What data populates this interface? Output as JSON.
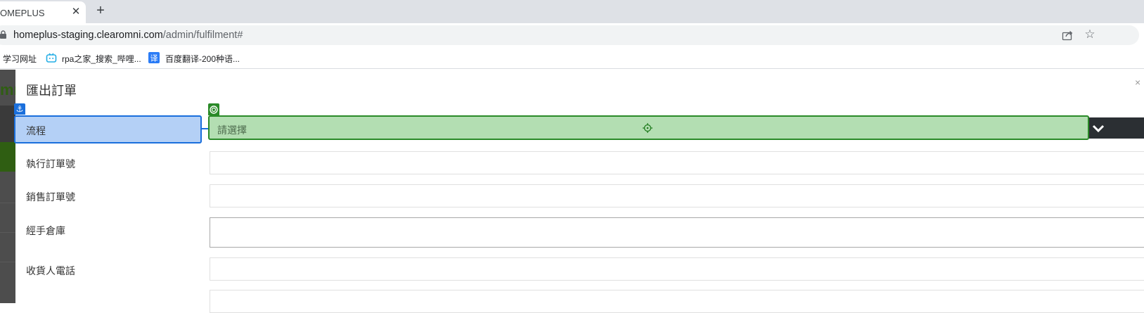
{
  "browser": {
    "tab_title": "OMEPLUS",
    "tab_close": "✕",
    "new_tab": "+",
    "url_host": "homeplus-staging.clearomni.com",
    "url_path": "/admin/fulfilment#",
    "bookmarks": [
      {
        "label": "学习网址",
        "icon": "none"
      },
      {
        "label": "rpa之家_搜索_哔哩...",
        "icon": "bilibili-icon"
      },
      {
        "label": "百度翻译-200种语...",
        "icon": "translate-icon"
      }
    ]
  },
  "backdrop": {
    "logo_fragment": "mn"
  },
  "modal": {
    "title": "匯出訂單",
    "close": "×",
    "rows": [
      {
        "label": "流程",
        "placeholder": "請選擇",
        "type": "select"
      },
      {
        "label": "執行訂單號",
        "value": "",
        "type": "text"
      },
      {
        "label": "銷售訂單號",
        "value": "",
        "type": "text"
      },
      {
        "label": "經手倉庫",
        "value": "",
        "type": "textarea"
      },
      {
        "label": "收貨人電話",
        "value": "",
        "type": "text"
      }
    ]
  },
  "colors": {
    "anchor_blue": "#1a6fdc",
    "target_green": "#2a8a28",
    "select_fill": "#b3deb2"
  }
}
